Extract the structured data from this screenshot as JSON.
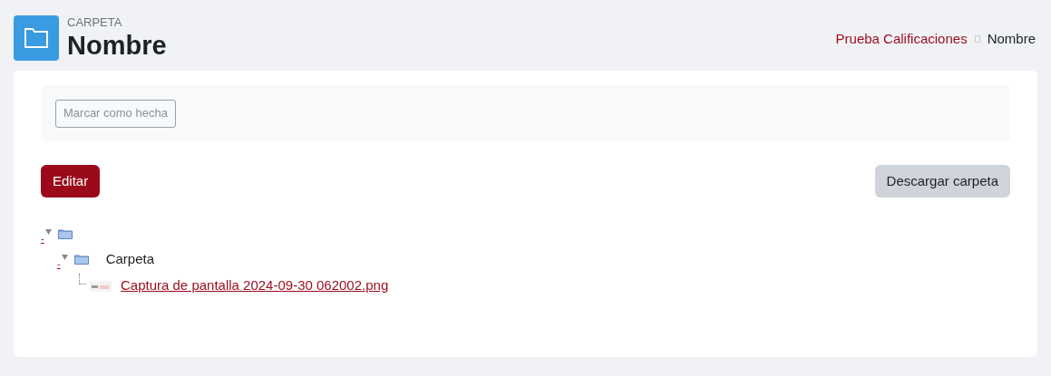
{
  "header": {
    "kind_label": "CARPETA",
    "title": "Nombre"
  },
  "breadcrumb": [
    {
      "label": "Prueba Calificaciones",
      "kind": "link"
    },
    {
      "label": "Nombre",
      "kind": "current"
    }
  ],
  "completion": {
    "label": "Marcar como hecha",
    "checked": false
  },
  "actions": [
    {
      "label": "Editar",
      "kind": "primary"
    },
    {
      "label": "Descargar carpeta",
      "kind": "secondary"
    }
  ],
  "tree": [
    {
      "kind": "folder",
      "toggle": "-",
      "expanded": true,
      "children": [
        {
          "kind": "folder",
          "toggle": "-",
          "label": "Carpeta",
          "expanded": true,
          "children": [
            {
              "kind": "file",
              "label": "Captura de pantalla 2024-09-30 062002.png"
            }
          ]
        }
      ]
    }
  ]
}
